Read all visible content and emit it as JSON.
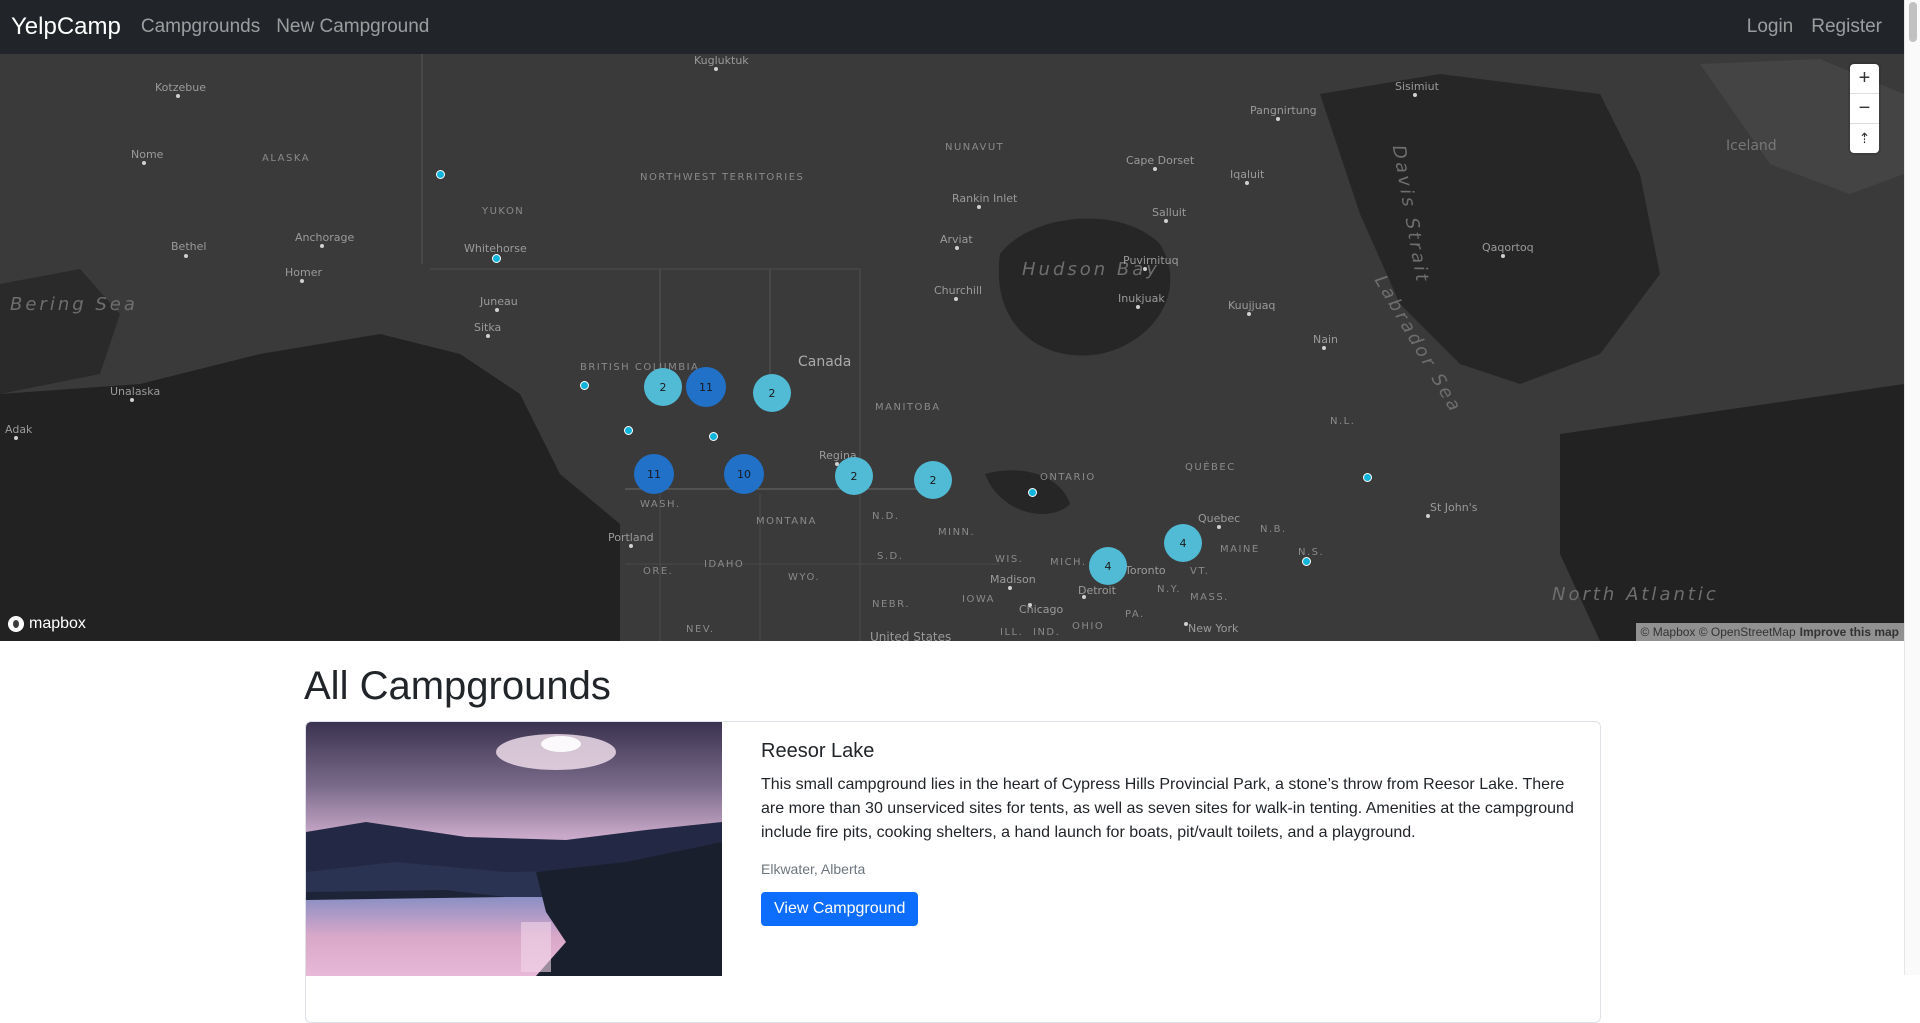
{
  "nav": {
    "brand": "YelpCamp",
    "links": [
      "Campgrounds",
      "New Campground"
    ],
    "right_links": [
      "Login",
      "Register"
    ]
  },
  "map": {
    "countries": [
      "Canada",
      "United States"
    ],
    "regions": [
      "ALASKA",
      "YUKON",
      "NORTHWEST TERRITORIES",
      "NUNAVUT",
      "BRITISH COLUMBIA",
      "MANITOBA",
      "ONTARIO",
      "QUÉBEC",
      "N.L.",
      "N.B.",
      "N.S.",
      "MAINE",
      "VT.",
      "N.Y.",
      "MASS.",
      "PA.",
      "OHIO",
      "IND.",
      "ILL.",
      "IOWA",
      "MICH.",
      "WIS.",
      "MINN.",
      "N.D.",
      "S.D.",
      "NEBR.",
      "WYO.",
      "IDAHO",
      "MONTANA",
      "ORE.",
      "WASH.",
      "NEV."
    ],
    "waters": [
      "Bering Sea",
      "Hudson Bay",
      "Davis Strait",
      "Labrador Sea",
      "North Atlantic"
    ],
    "cities": [
      "Kugluktuk",
      "Kotzebue",
      "Nome",
      "Bethel",
      "Anchorage",
      "Homer",
      "Whitehorse",
      "Juneau",
      "Sitka",
      "Unalaska",
      "Adak",
      "Rankin Inlet",
      "Arviat",
      "Churchill",
      "Cape Dorset",
      "Iqaluit",
      "Pangnirtung",
      "Sisimiut",
      "Salluit",
      "Puvirnituq",
      "Inukjuak",
      "Kuujjuaq",
      "Nain",
      "Qaqortoq",
      "Iceland",
      "Regina",
      "Portland",
      "Madison",
      "Chicago",
      "Detroit",
      "Toronto",
      "Quebec",
      "New York",
      "St John's"
    ],
    "clusters": [
      {
        "count": "2",
        "shade": "light"
      },
      {
        "count": "11",
        "shade": "dark"
      },
      {
        "count": "2",
        "shade": "light"
      },
      {
        "count": "10",
        "shade": "dark"
      },
      {
        "count": "11",
        "shade": "dark"
      },
      {
        "count": "2",
        "shade": "light"
      },
      {
        "count": "2",
        "shade": "light"
      },
      {
        "count": "4",
        "shade": "light"
      },
      {
        "count": "4",
        "shade": "light"
      }
    ],
    "controls": [
      "+",
      "−",
      "⇡"
    ],
    "logo": "mapbox",
    "attribution": "© Mapbox © OpenStreetMap",
    "improve_link": "Improve this map",
    "colors": {
      "land": "#3a3a3a",
      "water": "#1f1f1f",
      "cluster_light": "#51bbd6",
      "cluster_dark": "#2171c9",
      "point": "#11b4da"
    }
  },
  "page": {
    "title": "All Campgrounds"
  },
  "campgrounds": [
    {
      "title": "Reesor Lake",
      "description": "This small campground lies in the heart of Cypress Hills Provincial Park, a stone’s throw from Reesor Lake. There are more than 30 unserviced sites for tents, as well as seven sites for walk-in tenting. Amenities at the campground include fire pits, cooking shelters, a hand launch for boats, pit/vault toilets, and a playground.",
      "location": "Elkwater, Alberta",
      "button": "View Campground"
    }
  ]
}
